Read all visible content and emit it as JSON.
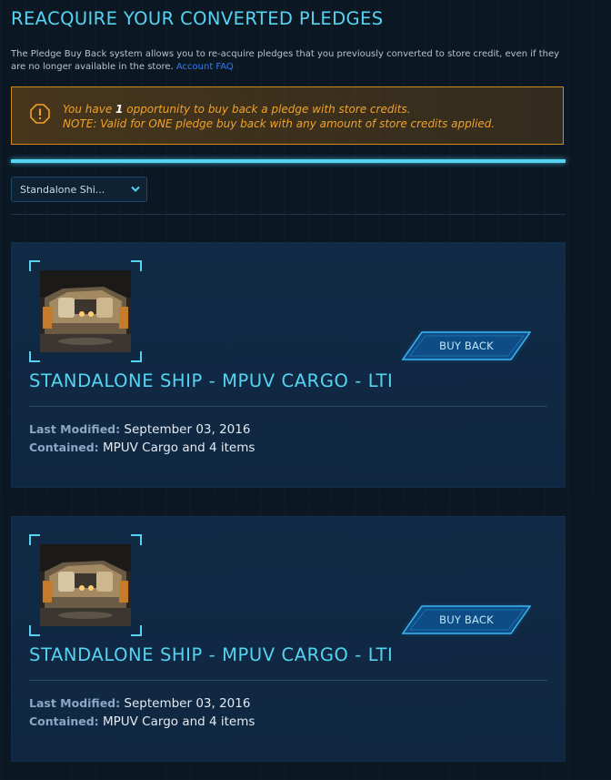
{
  "page": {
    "title": "REACQUIRE YOUR CONVERTED PLEDGES",
    "intro_text": "The Pledge Buy Back system allows you to re-acquire pledges that you previously converted to store credit, even if they are no longer available in the store.",
    "intro_link": "Account FAQ"
  },
  "notice": {
    "line1_prefix": "You have",
    "line1_count": "1",
    "line1_suffix": "opportunity to buy back a pledge with store credits.",
    "line2": "NOTE: Valid for ONE pledge buy back with any amount of store credits applied.",
    "icon": "warning-icon",
    "color": "#cf8a1c"
  },
  "filter": {
    "selected": "Standalone Shi..."
  },
  "labels": {
    "last_modified": "Last Modified:",
    "contained": "Contained:",
    "buy_back": "BUY BACK"
  },
  "pledges": [
    {
      "title": "STANDALONE SHIP - MPUV CARGO - LTI",
      "last_modified": "September 03, 2016",
      "contained": "MPUV Cargo and 4 items"
    },
    {
      "title": "STANDALONE SHIP - MPUV CARGO - LTI",
      "last_modified": "September 03, 2016",
      "contained": "MPUV Cargo and 4 items"
    }
  ],
  "colors": {
    "accent": "#55d4f2",
    "warning": "#f1a22a",
    "card_bg": "#112a45",
    "link": "#2f7cf2"
  }
}
